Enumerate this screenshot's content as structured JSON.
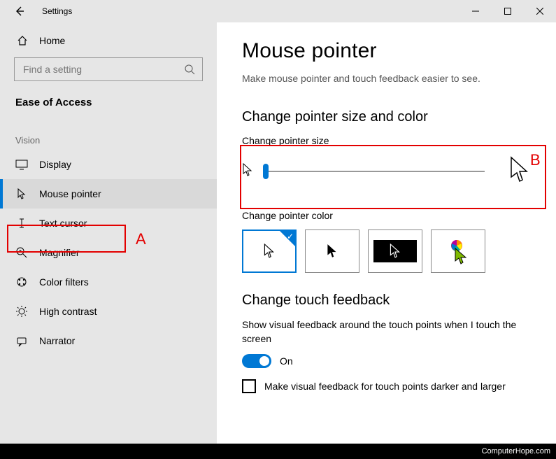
{
  "window": {
    "title": "Settings"
  },
  "window_controls": {
    "minimize": "minimize",
    "maximize": "maximize",
    "close": "close"
  },
  "sidebar": {
    "home_label": "Home",
    "search_placeholder": "Find a setting",
    "category": "Ease of Access",
    "section": "Vision",
    "items": [
      {
        "label": "Display",
        "icon": "display-icon"
      },
      {
        "label": "Mouse pointer",
        "icon": "mouse-pointer-icon",
        "active": true
      },
      {
        "label": "Text cursor",
        "icon": "text-cursor-icon"
      },
      {
        "label": "Magnifier",
        "icon": "magnifier-icon"
      },
      {
        "label": "Color filters",
        "icon": "color-filters-icon"
      },
      {
        "label": "High contrast",
        "icon": "high-contrast-icon"
      },
      {
        "label": "Narrator",
        "icon": "narrator-icon"
      }
    ]
  },
  "content": {
    "title": "Mouse pointer",
    "subtitle": "Make mouse pointer and touch feedback easier to see.",
    "size_color_heading": "Change pointer size and color",
    "size_label": "Change pointer size",
    "slider_value": 1,
    "slider_min": 1,
    "slider_max": 15,
    "color_label": "Change pointer color",
    "color_options": [
      "white",
      "black",
      "inverted",
      "custom"
    ],
    "color_selected": "white",
    "touch_heading": "Change touch feedback",
    "touch_desc": "Show visual feedback around the touch points when I touch the screen",
    "touch_toggle_state": "On",
    "touch_checkbox_label": "Make visual feedback for touch points darker and larger",
    "touch_checkbox_checked": false
  },
  "annotations": {
    "A": "A",
    "B": "B"
  },
  "footer": "ComputerHope.com"
}
